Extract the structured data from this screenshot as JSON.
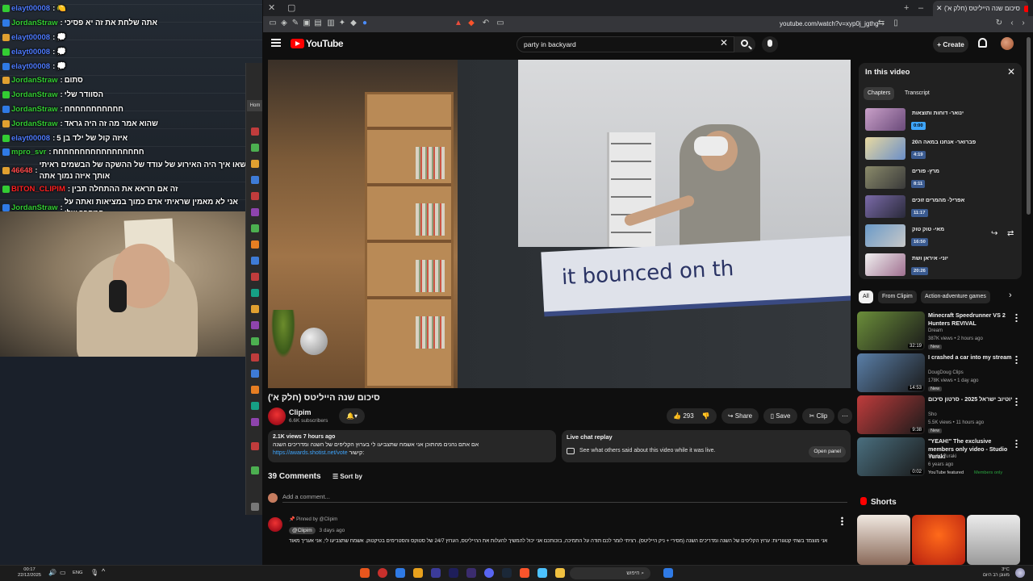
{
  "chat": {
    "lines": [
      {
        "user": "elayt00008",
        "user_color": "#4e7bff",
        "msg": "🍋"
      },
      {
        "user": "JordanStraw",
        "user_color": "#33cc33",
        "msg": "אתה שלחת את זה יא פסיכי"
      },
      {
        "user": "elayt00008",
        "user_color": "#4e7bff",
        "msg": "💭"
      },
      {
        "user": "elayt00008",
        "user_color": "#4e7bff",
        "msg": "💭"
      },
      {
        "user": "elayt00008",
        "user_color": "#4e7bff",
        "msg": "💭"
      },
      {
        "user": "JordanStraw",
        "user_color": "#33cc33",
        "msg": "סתום"
      },
      {
        "user": "JordanStraw",
        "user_color": "#33cc33",
        "msg": "הסוודר שלי"
      },
      {
        "user": "JordanStraw",
        "user_color": "#33cc33",
        "msg": "חחחחחחחחחחח"
      },
      {
        "user": "JordanStraw",
        "user_color": "#33cc33",
        "msg": "שהוא אמר מה זה היה גראד"
      },
      {
        "user": "elayt00008",
        "user_color": "#4e7bff",
        "msg": "איזה קול של ילד בן 5"
      },
      {
        "user": "mpro_svr",
        "user_color": "#33cc33",
        "msg": "חחחחחחחחחחחחחחחחח"
      },
      {
        "user": "46648",
        "user_color": "#ff4b4b",
        "msg": "שאו איך היה האירוע של עודד של ההשקה של הבשמים ראיתי אותך איזה נמוך אתה"
      },
      {
        "user": "BITON_CLIPIM",
        "user_color": "#ff2020",
        "msg": "זה אם תראא את ההתחלה תבין"
      },
      {
        "user": "JordanStraw",
        "user_color": "#33cc33",
        "msg": "אני לא מאמין שראיתי אדם כמוך במציאות ואתה על המקרר שלי"
      }
    ]
  },
  "browser": {
    "tab_title": "סיכום שנה הייליטס (חלק א')",
    "url": "youtube.com/watch?v=xyp0j_jgthg"
  },
  "youtube": {
    "logo": "YouTube",
    "search_value": "party in backyard",
    "create_label": "Create",
    "video_overlay_text": "it bounced on th",
    "video_title": "סיכום שנה הייליטס (חלק א')",
    "channel": {
      "name": "Clipim",
      "subs": "6.6K subscribers"
    },
    "likes": "293",
    "share_label": "Share",
    "save_label": "Save",
    "clip_label": "Clip",
    "description": {
      "meta": "2.1K views  7 hours ago",
      "text": "אם אתם נהנים מהתוכן אני אשמח שתצביעו לי בערוץ הקליפים של השנה ומדריכים השנה",
      "link": "https://awards.shotist.net/vote",
      "link_suffix": "קישור:"
    },
    "chat_replay": {
      "title": "Live chat replay",
      "subtitle": "See what others said about this video while it was live.",
      "button": "Open panel"
    },
    "comments_count": "39 Comments",
    "sort_label": "Sort by",
    "add_comment_placeholder": "Add a comment...",
    "pinned_comment": {
      "pinned_by": "Pinned by @Clipim",
      "author": "@Clipim",
      "time": "3 days ago",
      "text": "אני מוצמד בשתי קטגוריות: ערוץ הקליפים של השנה ומדריכים השנה (מסירי + ניק הייליטס). רציתי לומר לכם תודה על התמיכה, בזכותכם אני יכול להמשיך להעלות את ההייליטס, הערוץ 24/7 של סטוקס והסטרימים בטיקטוק. אשמח שתצביעו לי, אני אעריך מאוד"
    },
    "in_this_video": {
      "title": "In this video",
      "tabs": [
        "Chapters",
        "Transcript"
      ],
      "chapters": [
        {
          "label": "ינואר- דוחות ותוצאות",
          "time": "0:00"
        },
        {
          "label": "פברואר- אנחנו במאה ה20",
          "time": "4:19"
        },
        {
          "label": "מרץ- פורים",
          "time": "8:11"
        },
        {
          "label": "אפריל- מהמרים זוכים",
          "time": "11:17"
        },
        {
          "label": "מאי- טוק טוק",
          "time": "16:50"
        },
        {
          "label": "יוני- איראן ושת",
          "time": "20:26"
        }
      ]
    },
    "filters": [
      "All",
      "From Clipim",
      "Action-adventure games"
    ],
    "recommended": [
      {
        "title": "Minecraft Speedrunner VS 2 Hunters REVIVAL",
        "channel": "Dream",
        "meta": "387K views • 2 hours ago",
        "badge": "New",
        "duration": "32:19",
        "thumb": "#6b8e3a"
      },
      {
        "title": "I crashed a car into my stream",
        "channel": "DougDoug Clips",
        "meta": "178K views • 1 day ago",
        "badge": "New",
        "duration": "14:53",
        "thumb": "#5a7fa8"
      },
      {
        "title": "יוטיוב ישראל 2025 - סרטון סיכום",
        "channel": "Sho",
        "meta": "5.5K views • 11 hours ago",
        "badge": "New",
        "duration": "9:38",
        "thumb": "#c03c3c"
      },
      {
        "title": "\"YEAH!\" The exclusive members only video - Studio Yuraki",
        "channel": "Studio Yuraki",
        "meta": "6 years ago",
        "badge": "YouTube featured",
        "badge2": "Members only",
        "duration": "0:02",
        "thumb": "#4a6f7f"
      }
    ],
    "shorts_title": "Shorts"
  },
  "taskbar": {
    "time": "00:17",
    "date": "22/12/2025",
    "lang": "ENG",
    "search": "חיפוש",
    "weather_temp": "3°C",
    "weather_desc": "מעונן רב היום"
  }
}
